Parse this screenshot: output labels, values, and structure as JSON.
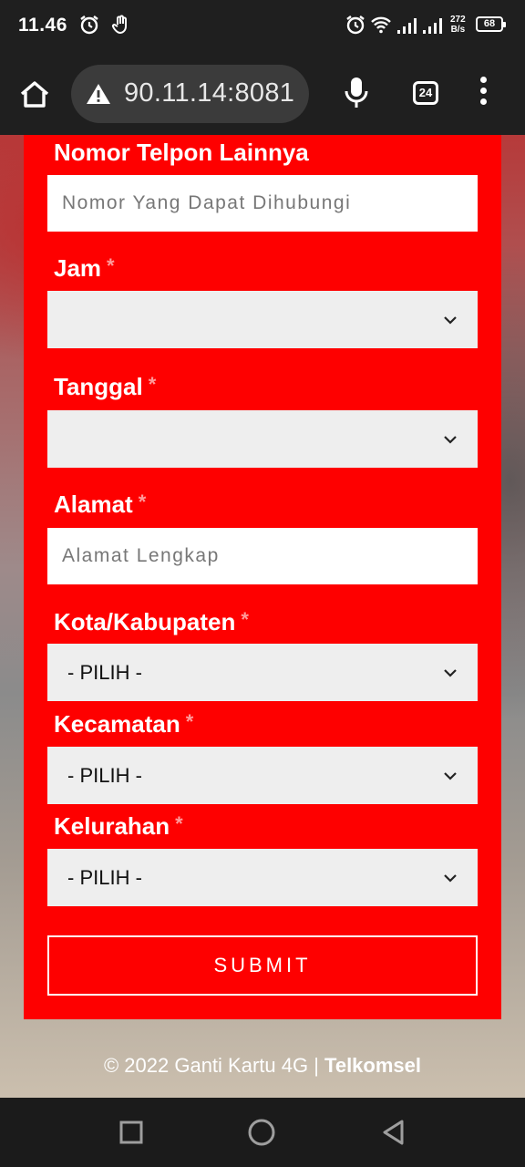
{
  "status_bar": {
    "time": "11.46",
    "net_speed_value": "272",
    "net_speed_unit": "B/s",
    "battery": "68"
  },
  "browser": {
    "url": "90.11.14:8081",
    "tab_count": "24"
  },
  "form": {
    "other_phone": {
      "label": "Nomor Telpon Lainnya",
      "placeholder": "Nomor Yang Dapat Dihubungi"
    },
    "hour": {
      "label": "Jam",
      "required_mark": "*",
      "value": ""
    },
    "date": {
      "label": "Tanggal",
      "required_mark": "*",
      "value": ""
    },
    "address": {
      "label": "Alamat",
      "required_mark": "*",
      "placeholder": "Alamat Lengkap"
    },
    "city": {
      "label": "Kota/Kabupaten",
      "required_mark": "*",
      "value": "- PILIH -"
    },
    "district": {
      "label": "Kecamatan",
      "required_mark": "*",
      "value": "- PILIH -"
    },
    "subdistrict": {
      "label": "Kelurahan",
      "required_mark": "*",
      "value": "- PILIH -"
    },
    "submit_label": "SUBMIT"
  },
  "footer": {
    "text": "© 2022 Ganti Kartu 4G | ",
    "brand": "Telkomsel"
  },
  "colors": {
    "form_background": "#fe0000",
    "chrome_background": "#1f1f1f",
    "select_background": "#eeeeee"
  }
}
